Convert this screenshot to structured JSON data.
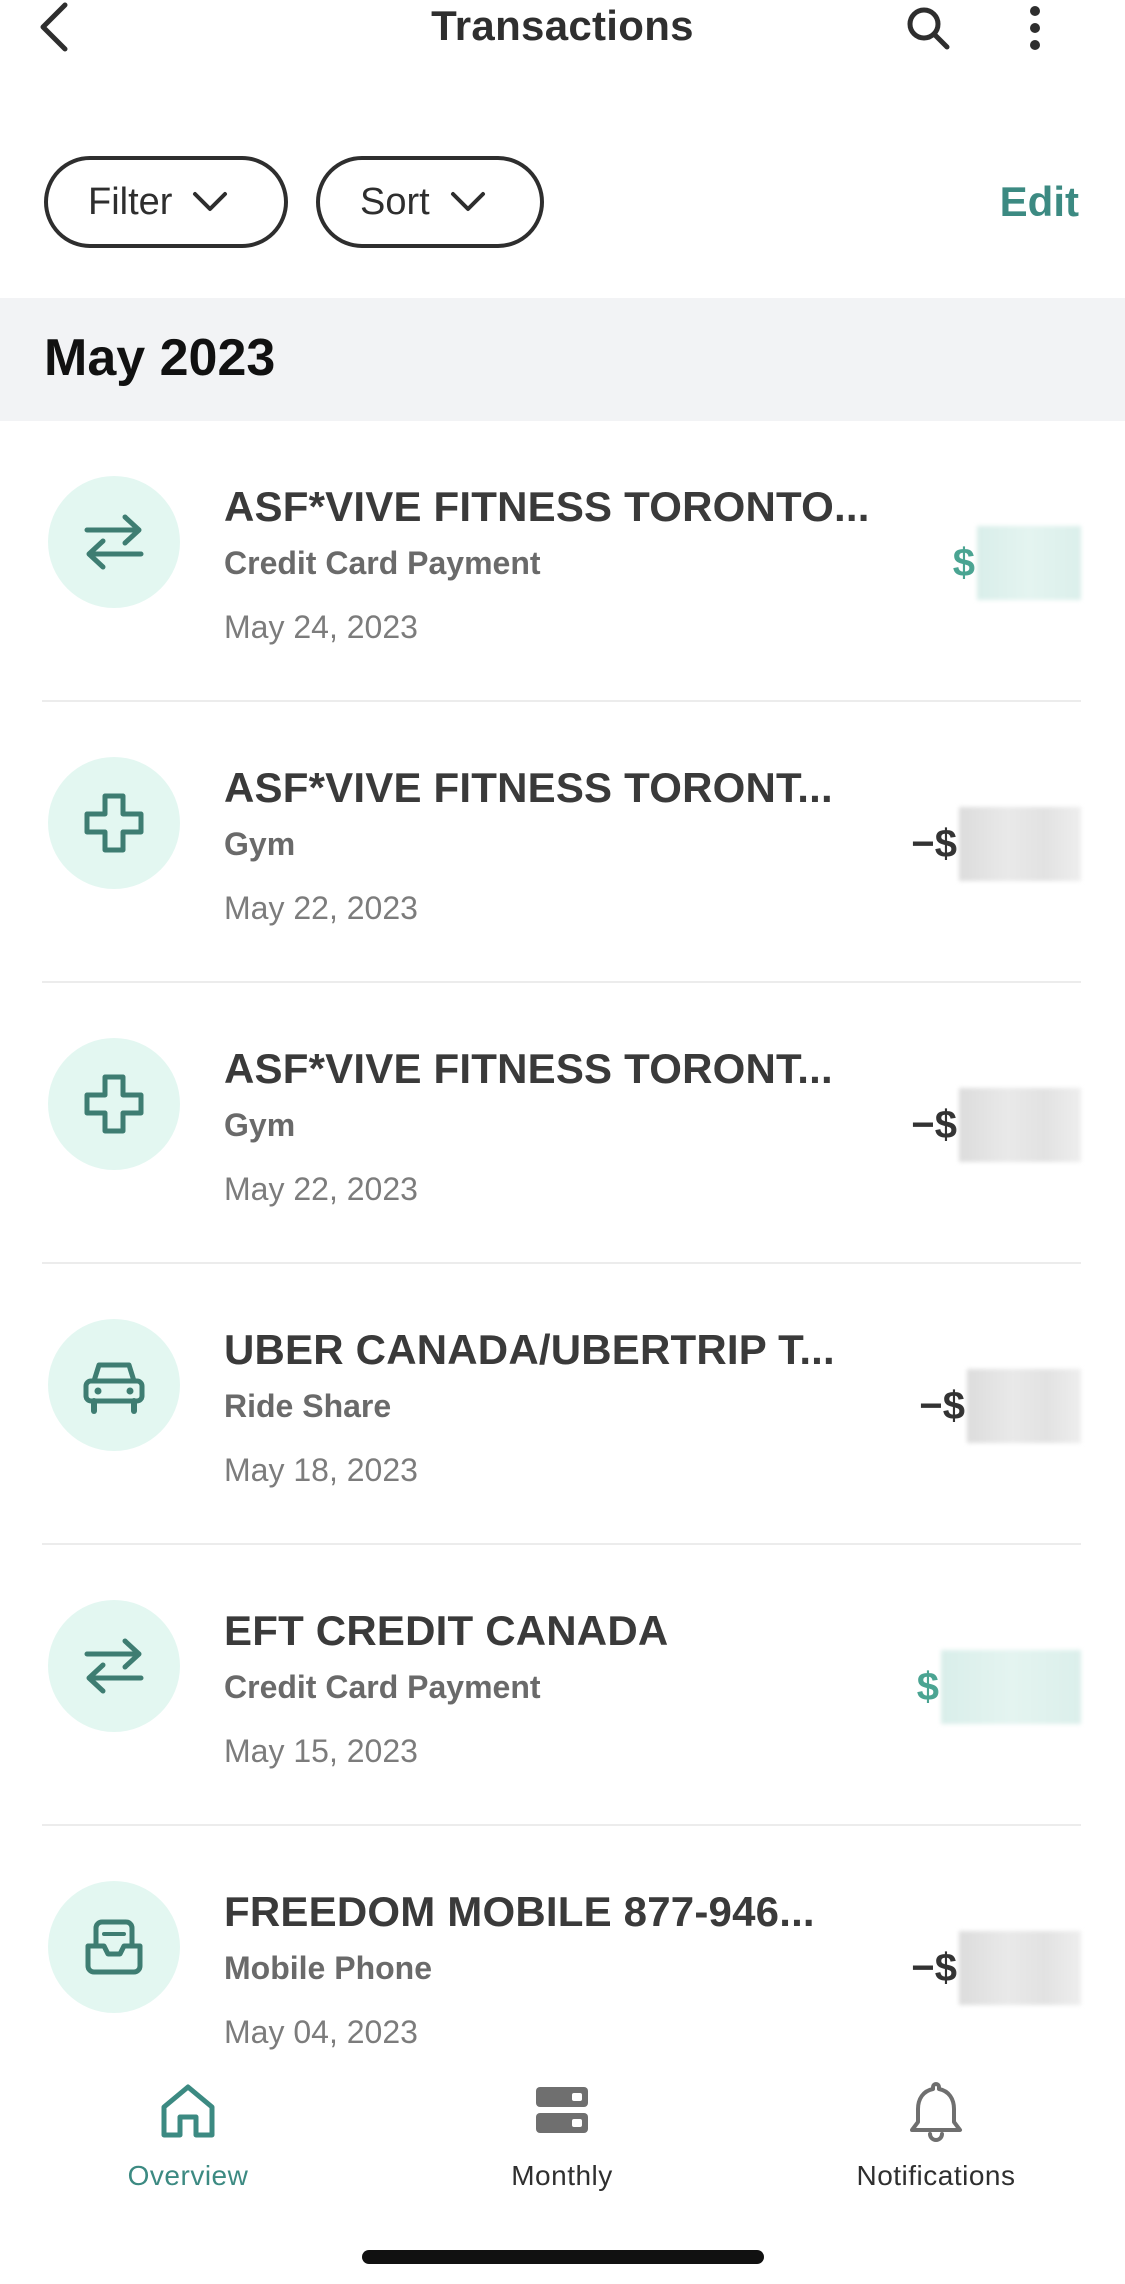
{
  "header": {
    "title": "Transactions"
  },
  "toolbar": {
    "filter_label": "Filter",
    "sort_label": "Sort",
    "edit_label": "Edit"
  },
  "section": {
    "title": "May 2023"
  },
  "transactions": [
    {
      "name": "ASF*VIVE FITNESS TORONTO...",
      "category": "Credit Card Payment",
      "date": "May 24, 2023",
      "amount_sign": "$",
      "type": "credit",
      "icon": "transfer-arrows-icon"
    },
    {
      "name": "ASF*VIVE FITNESS TORONT...",
      "category": "Gym",
      "date": "May 22, 2023",
      "amount_sign": "−$",
      "type": "debit",
      "icon": "medical-cross-icon"
    },
    {
      "name": "ASF*VIVE FITNESS TORONT...",
      "category": "Gym",
      "date": "May 22, 2023",
      "amount_sign": "−$",
      "type": "debit",
      "icon": "medical-cross-icon"
    },
    {
      "name": "UBER CANADA/UBERTRIP T...",
      "category": "Ride Share",
      "date": "May 18, 2023",
      "amount_sign": "−$",
      "type": "debit",
      "icon": "car-icon"
    },
    {
      "name": "EFT CREDIT CANADA",
      "category": "Credit Card Payment",
      "date": "May 15, 2023",
      "amount_sign": "$",
      "type": "credit",
      "icon": "transfer-arrows-icon"
    },
    {
      "name": "FREEDOM MOBILE 877-946...",
      "category": "Mobile Phone",
      "date": "May 04, 2023",
      "amount_sign": "−$",
      "type": "debit",
      "icon": "mobile-phone-icon"
    }
  ],
  "tabs": [
    {
      "label": "Overview",
      "icon": "home-icon",
      "active": true
    },
    {
      "label": "Monthly",
      "icon": "monthly-cards-icon",
      "active": false
    },
    {
      "label": "Notifications",
      "icon": "bell-icon",
      "active": false
    }
  ],
  "colors": {
    "accent": "#3c8a82",
    "credit_green": "#4aa492",
    "icon_bg": "#e3f7f1",
    "section_bg": "#f2f3f5"
  }
}
